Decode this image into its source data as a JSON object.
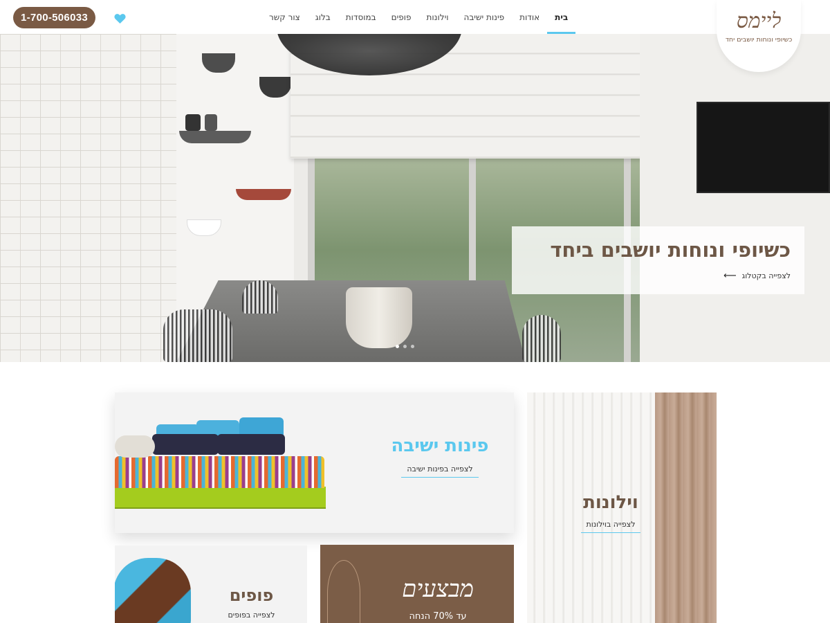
{
  "header": {
    "phone": "1-700-506033",
    "logo_script": "ליימס",
    "logo_tagline": "כשיופי ונוחות יושבים יחד",
    "nav": [
      {
        "label": "בית",
        "active": true
      },
      {
        "label": "אודות",
        "active": false
      },
      {
        "label": "פינות ישיבה",
        "active": false
      },
      {
        "label": "וילונות",
        "active": false
      },
      {
        "label": "פופים",
        "active": false
      },
      {
        "label": "במוסדות",
        "active": false
      },
      {
        "label": "בלוג",
        "active": false
      },
      {
        "label": "צור קשר",
        "active": false
      }
    ]
  },
  "hero": {
    "title": "כשיופי ונוחות יושבים ביחד",
    "link": "לצפייה בקטלוג",
    "slides": 3,
    "active_slide": 1
  },
  "categories": {
    "seating": {
      "title": "פינות ישיבה",
      "link": "לצפייה בפינות ישיבה"
    },
    "curtains": {
      "title": "וילונות",
      "link": "לצפייה בוילונות"
    },
    "poufs": {
      "title": "פופים",
      "link": "לצפייה בפופים"
    },
    "deals": {
      "title": "מבצעים",
      "subtitle": "עד 70% הנחה"
    }
  },
  "colors": {
    "brand_brown": "#7a5a44",
    "accent_blue": "#5bc8ee",
    "heading_brown": "#6d5746"
  },
  "icons": {
    "wishlist": "heart-icon",
    "hero_arrow": "arrow-left-icon"
  }
}
